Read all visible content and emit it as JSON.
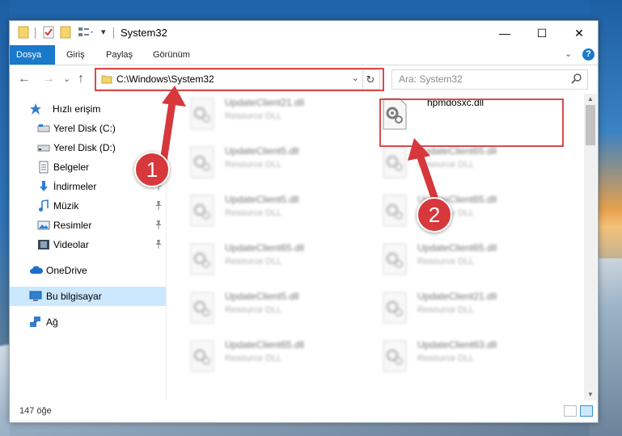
{
  "window": {
    "title": "System32",
    "minimize": "—",
    "maximize": "☐",
    "close": "✕"
  },
  "ribbon": {
    "tabs": [
      "Dosya",
      "Giriş",
      "Paylaş",
      "Görünüm"
    ],
    "expand": "⌄",
    "help": "?"
  },
  "nav": {
    "back": "←",
    "forward": "→",
    "recent": "⌄",
    "up": "↑",
    "address_path": "C:\\Windows\\System32",
    "address_dropdown": "⌄",
    "refresh": "↻",
    "search_placeholder": "Ara: System32"
  },
  "sidebar": {
    "items": [
      {
        "label": "Hızlı erişim",
        "icon": "star-icon",
        "pinned": false
      },
      {
        "label": "Yerel Disk (C:)",
        "icon": "drive-icon",
        "pinned": false
      },
      {
        "label": "Yerel Disk (D:)",
        "icon": "drive-icon",
        "pinned": false
      },
      {
        "label": "Belgeler",
        "icon": "documents-icon",
        "pinned": false
      },
      {
        "label": "İndirmeler",
        "icon": "download-icon",
        "pinned": true
      },
      {
        "label": "Müzik",
        "icon": "music-icon",
        "pinned": true
      },
      {
        "label": "Resimler",
        "icon": "pictures-icon",
        "pinned": true
      },
      {
        "label": "Videolar",
        "icon": "videos-icon",
        "pinned": true
      },
      {
        "label": "OneDrive",
        "icon": "cloud-icon",
        "pinned": false
      },
      {
        "label": "Bu bilgisayar",
        "icon": "computer-icon",
        "pinned": false,
        "selected": true
      },
      {
        "label": "Ağ",
        "icon": "network-icon",
        "pinned": false
      }
    ],
    "pin_glyph": "📌"
  },
  "files": {
    "left_column": [
      {
        "name": "UpdateClient21.dll",
        "type": "Resource DLL"
      },
      {
        "name": "UpdateClient5.dll",
        "type": "Resource DLL"
      },
      {
        "name": "UpdateClient5.dll",
        "type": "Resource DLL"
      },
      {
        "name": "UpdateClient65.dll",
        "type": "Resource DLL"
      },
      {
        "name": "UpdateClient5.dll",
        "type": "Resource DLL"
      },
      {
        "name": "UpdateClient65.dll",
        "type": "Resource DLL"
      }
    ],
    "right_column": [
      {
        "name": "hpmdosxc.dll",
        "type": "",
        "highlighted": true
      },
      {
        "name": "UpdateClient65.dll",
        "type": "Resource DLL"
      },
      {
        "name": "UpdateClient65.dll",
        "type": "Resource DLL"
      },
      {
        "name": "UpdateClient65.dll",
        "type": "Resource DLL"
      },
      {
        "name": "UpdateClient21.dll",
        "type": "Resource DLL"
      },
      {
        "name": "UpdateClient63.dll",
        "type": "Resource DLL"
      }
    ]
  },
  "status": {
    "item_count": "147 öğe"
  },
  "annotations": {
    "step1": "1",
    "step2": "2",
    "color": "#d6383c"
  }
}
